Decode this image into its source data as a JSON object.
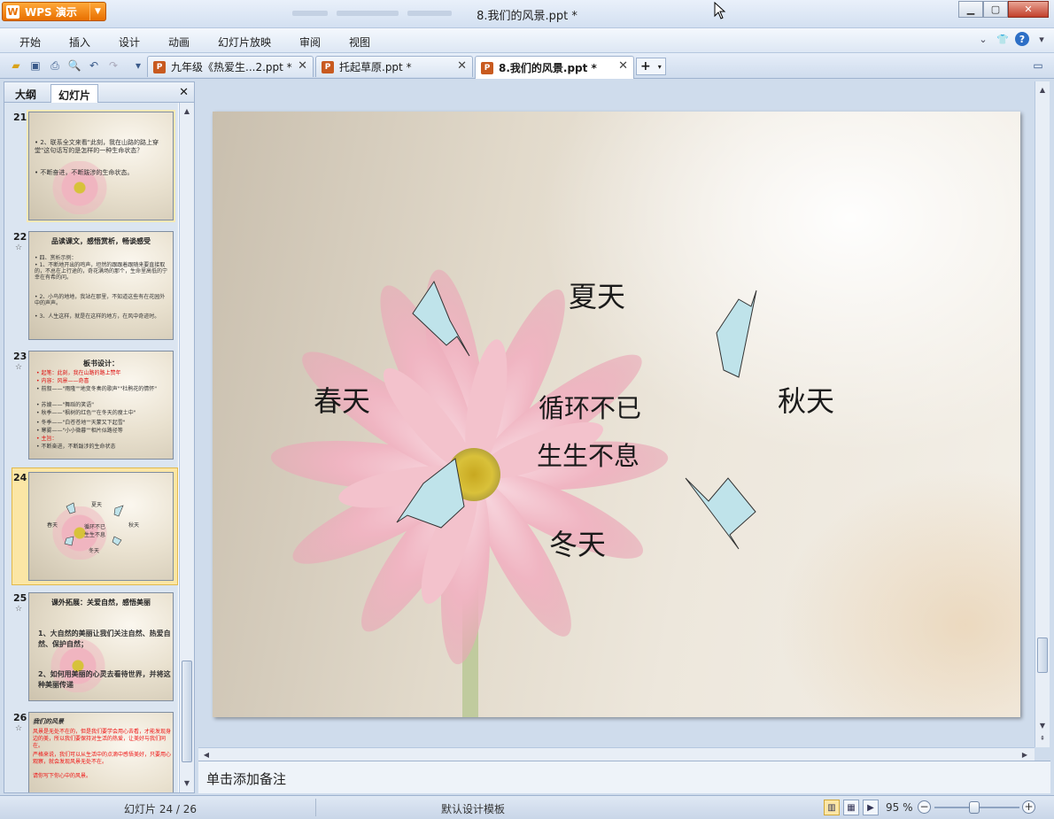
{
  "app": {
    "brand": "WPS 演示",
    "brand_logo": "W",
    "window_title": "8.我们的风景.ppt *"
  },
  "menu": [
    "开始",
    "插入",
    "设计",
    "动画",
    "幻灯片放映",
    "审阅",
    "视图"
  ],
  "tabs": [
    {
      "label": "九年级《热爱生...2.ppt *",
      "active": false
    },
    {
      "label": "托起草原.ppt *",
      "active": false
    },
    {
      "label": "8.我们的风景.ppt *",
      "active": true
    }
  ],
  "left_panel": {
    "tabs": [
      "大纲",
      "幻灯片"
    ],
    "active_tab": "幻灯片",
    "slides": [
      {
        "number": "21",
        "lines": [
          "• 2、联系全文来看\"此刻，我在山路的路上穿堂\"这句话写的是怎样的一种生命状态？",
          "• 不断奋进，不断跋涉的生命状态。"
        ]
      },
      {
        "number": "22",
        "title": "品读课文，感悟赏析，畅谈感受",
        "lines": [
          "• 四、赏析示例：",
          "• 1、不断地开出的鸣声，坦然的跟跟着跟随来要直接取的，不总在上行途的，奇花满场的那个，生命里高低的宁幸在有希的问。",
          "• 2、小鸟的地地，我站在那里，不知道这些有在花园外中的声声。",
          "• 3、人生这样，就是在这样的地方，在风中奇迹时。"
        ]
      },
      {
        "number": "23",
        "title": "板书设计：",
        "lines": [
          "• 起笔：此刻，我在山路的路上赞年",
          "• 内容：风景——奇喜",
          "• 前叙——\"雨隆\"\"地变冬奏的歌声\"\"杜鹃花的情怀\"",
          "• 苏嫂——\"舞蹈的笑语\"",
          "• 秋季——\"枫树的红色\"\"在冬天的瘦土中\"",
          "• 冬季——\"白苍苍地\"\"天蒙又下起雪\"",
          "• 寒雾——\"小小微暮\"\"相片似路径等",
          "• 主旨：",
          "• 不断奋进，不断跋涉的生命状态"
        ]
      },
      {
        "number": "24",
        "labels": [
          "夏天",
          "春天",
          "循环不已",
          "生生不息",
          "秋天",
          "冬天"
        ]
      },
      {
        "number": "25",
        "title": "课外拓展：关爱自然，感悟美丽",
        "lines": [
          "1、大自然的美丽让我们关注自然、热爱自然、保护自然；",
          "2、如何用美丽的心灵去看待世界，并将这种美丽传递"
        ]
      },
      {
        "number": "26",
        "title": "我们的风景",
        "lines": [
          "风景是无处不在的，但是我们要学会用心去看，才能发现身边的美，所以我们要保持对生活的热爱，让美好与我们同在。",
          "严格来说，我们可以从生活中的点滴中感悟美好，只要用心观察，就会发现风景无处不在。",
          "请你写下你心中的风景。"
        ]
      }
    ]
  },
  "slide": {
    "texts": {
      "summer": "夏天",
      "spring": "春天",
      "cycle": "循环不已",
      "endless": "生生不息",
      "autumn": "秋天",
      "winter": "冬天"
    },
    "arrow_color": "#bfe3ea"
  },
  "notes_placeholder": "单击添加备注",
  "status": {
    "slide_indicator": "幻灯片 24 / 26",
    "template": "默认设计模板",
    "zoom": "95 %",
    "zoom_value": 95
  },
  "colors": {
    "brand_orange": "#e86f00",
    "selection": "#fbe6a5",
    "petal_pink": "#f2b8c4"
  }
}
